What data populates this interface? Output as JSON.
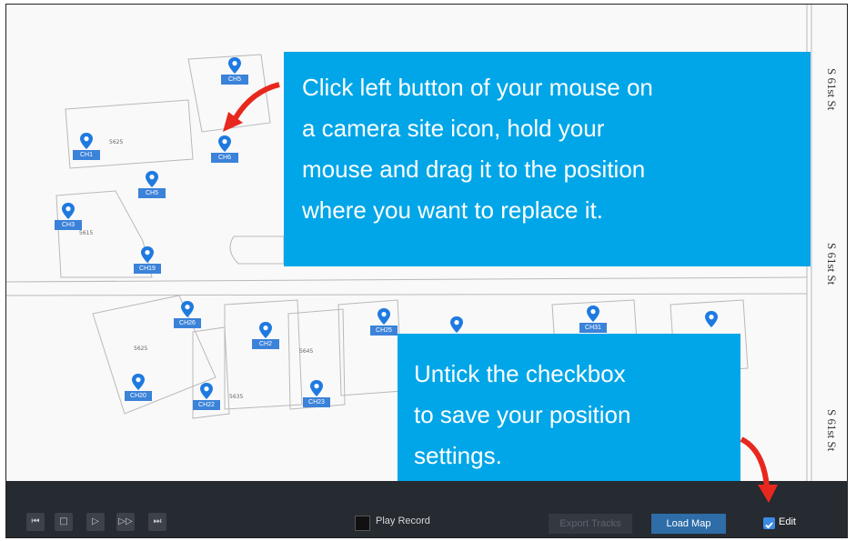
{
  "map": {
    "streets": [
      "S 61st St",
      "S 61st St",
      "S 61st St"
    ],
    "lot_numbers": [
      "5625",
      "5615",
      "5625",
      "5645",
      "5635"
    ],
    "pins": [
      {
        "label": "CH5"
      },
      {
        "label": "CH1"
      },
      {
        "label": "CH6"
      },
      {
        "label": "CH5"
      },
      {
        "label": "CH3"
      },
      {
        "label": "CH19"
      },
      {
        "label": "CH26"
      },
      {
        "label": "CH2"
      },
      {
        "label": "CH20"
      },
      {
        "label": "CH22"
      },
      {
        "label": "CH23"
      },
      {
        "label": "CH25"
      },
      {
        "label": ""
      },
      {
        "label": "CH31"
      },
      {
        "label": ""
      }
    ],
    "pin_color": "#1f7ae0"
  },
  "callouts": {
    "top_lines": [
      "Click left button of your mouse on",
      "a camera site icon, hold your",
      "mouse and drag it to the position",
      "where you want to replace it."
    ],
    "bottom_lines": [
      "Untick the checkbox",
      "to save your position",
      "settings."
    ],
    "color": "#00a6e8",
    "arrow_color": "#e8281e"
  },
  "toolbar": {
    "playback_buttons": [
      {
        "icon": "skip-back-icon",
        "glyph": "⏮"
      },
      {
        "icon": "stop-icon",
        "glyph": "□"
      },
      {
        "icon": "play-icon",
        "glyph": "▷"
      },
      {
        "icon": "fast-forward-icon",
        "glyph": "▷▷"
      },
      {
        "icon": "skip-forward-icon",
        "glyph": "⏭"
      }
    ],
    "play_record_label": "Play Record",
    "play_record_checked": false,
    "export_tracks_label": "Export Tracks",
    "load_map_label": "Load Map",
    "edit_label": "Edit",
    "edit_checked": true
  }
}
